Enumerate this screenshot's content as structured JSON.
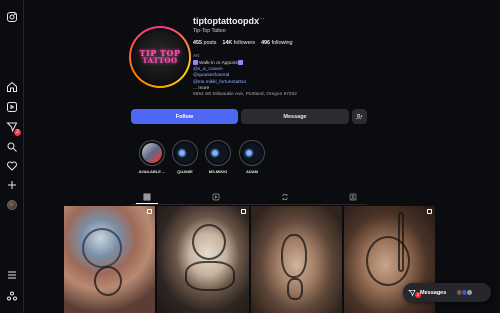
{
  "nav": {
    "message_badge": "2",
    "items": [
      "instagram-logo",
      "home",
      "reels",
      "messages",
      "search",
      "notifications",
      "create",
      "profile",
      "menu",
      "threads"
    ]
  },
  "profile": {
    "username": "tiptoptattoopdx",
    "more": "···",
    "full_name": "Tip-Top Tattoo",
    "avatar_text_line1": "TIP TOP",
    "avatar_text_line2": "TATTOO",
    "stats": {
      "posts_count": "455",
      "posts_label": "posts",
      "followers_count": "14K",
      "followers_label": "followers",
      "following_count": "496",
      "following_label": "following"
    },
    "bio": {
      "category": "Art",
      "line1": "Walk-in or Appoint",
      "link1": "@s_a_craven",
      "link2": "@quaniesfuneral",
      "link3": "@ms.mikki_fortunetattoo",
      "more": "... more",
      "address": "6654 SE Milwaukie Ave, Portland, Oregon 97202"
    }
  },
  "actions": {
    "follow_label": "Follow",
    "message_label": "Message"
  },
  "highlights": [
    {
      "label": "AVAILABLE ..."
    },
    {
      "label": "QUANIE"
    },
    {
      "label": "MS.MIKKI"
    },
    {
      "label": "ADAM"
    }
  ],
  "messages_pill": {
    "label": "Messages",
    "badge": "2"
  },
  "colors": {
    "accent": "#4e68f5",
    "background": "#0b0c0f",
    "badge": "#ff3040"
  }
}
